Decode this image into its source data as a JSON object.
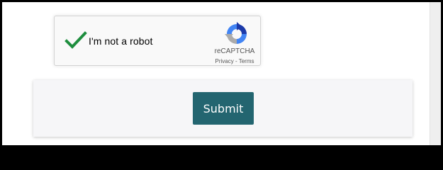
{
  "recaptcha": {
    "label": "I'm not a robot",
    "checked": true,
    "brand": "reCAPTCHA",
    "privacy_link": "Privacy",
    "separator": " - ",
    "terms_link": "Terms",
    "check_color": "#1e8e3e"
  },
  "form": {
    "submit_label": "Submit",
    "submit_color": "#236570"
  },
  "icons": {
    "checkmark": "checkmark-icon",
    "recaptcha_logo": "recaptcha-logo-icon"
  }
}
